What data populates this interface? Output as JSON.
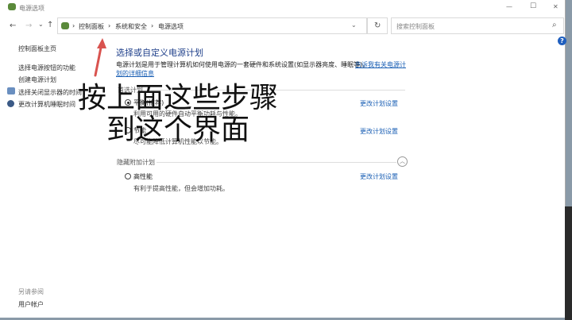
{
  "window": {
    "title": "电源选项",
    "minimize": "—",
    "maximize": "☐",
    "close": "✕"
  },
  "nav": {
    "back": "←",
    "forward": "→",
    "recent": "⌄",
    "up": "↑",
    "breadcrumb": [
      "控制面板",
      "系统和安全",
      "电源选项"
    ],
    "separator": "›",
    "dropdown": "⌄",
    "refresh": "↻",
    "search_placeholder": "搜索控制面板",
    "search_icon": "⌕",
    "help": "?"
  },
  "sidebar": {
    "items": [
      {
        "label": "控制面板主页"
      },
      {
        "label": "选择电源按钮的功能"
      },
      {
        "label": "创建电源计划"
      },
      {
        "label": "选择关闭显示器的时间"
      },
      {
        "label": "更改计算机睡眠时间"
      }
    ],
    "see_also": "另请参阅",
    "user_accounts": "用户帐户"
  },
  "main": {
    "title": "选择或自定义电源计划",
    "description": "电源计划是用于管理计算机如何使用电源的一套硬件和系统设置(如显示器亮度、睡眠等)。",
    "more_link": "告诉我有关电源计划的详细信息",
    "preferred_header": "首选计划",
    "hidden_header": "隐藏附加计划",
    "plans": [
      {
        "name": "平衡(推荐)",
        "desc": "利用可用的硬件自动平衡功耗与性能。",
        "link": "更改计划设置",
        "selected": true
      },
      {
        "name": "节能",
        "desc": "尽可能降低计算机性能以节能。",
        "link": "更改计划设置",
        "selected": false
      },
      {
        "name": "高性能",
        "desc": "有利于提高性能，但会增加功耗。",
        "link": "更改计划设置",
        "selected": false
      }
    ]
  },
  "overlay": {
    "line1": "按上面这些步骤",
    "line2": "到这个界面",
    "arrow_color": "#d9534f"
  }
}
